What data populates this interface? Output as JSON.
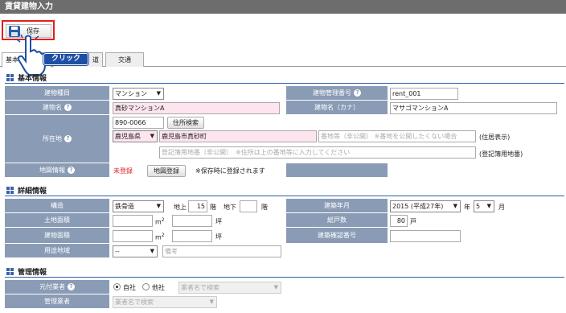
{
  "window": {
    "title": "賃貸建物入力"
  },
  "toolbar": {
    "save_label": "保存",
    "click_badge": "クリック"
  },
  "tabs": [
    {
      "label": "基本"
    },
    {
      "label": "道"
    },
    {
      "label": "交通"
    }
  ],
  "sections": {
    "basic": "基本情報",
    "detail": "詳細情報",
    "mgmt": "管理情報"
  },
  "basic": {
    "type_label": "建物種目",
    "type_value": "マンション",
    "mgmt_no_label": "建物管理番号",
    "mgmt_no_value": "rent_001",
    "name_label": "建物名",
    "name_value": "真砂マンションA",
    "kana_label": "建物名（カナ）",
    "kana_value": "マサゴマンションA",
    "address_label": "所在地",
    "zip_value": "890-0066",
    "zip_button": "住所検索",
    "pref_value": "鹿児島県",
    "city_value": "鹿児島市真砂町",
    "street_placeholder": "番地等（非公開）",
    "street_note": "※番地を公開したくない場合",
    "display_label": "(住居表示)",
    "reg_placeholder": "登記簿用地番（非公開）",
    "reg_note": "※住所は上の番地等に入力してください",
    "reg_label": "(登記簿用地番)",
    "map_label": "地図情報",
    "map_status": "未登録",
    "map_button": "地図登録",
    "map_note": "※保存時に登録されます"
  },
  "detail": {
    "structure_label": "構造",
    "structure_value": "鉄骨造",
    "above_label": "地上",
    "above_value": "15",
    "floor_unit": "階",
    "below_label": "地下",
    "below_unit": "階",
    "built_label": "建築年月",
    "year_value": "2015 (平成27年)",
    "year_unit": "年",
    "month_value": "5",
    "month_unit": "月",
    "land_label": "土地面積",
    "m2": "m",
    "sup": "2",
    "tsubo": "坪",
    "units_label": "総戸数",
    "units_value": "80",
    "units_unit": "戸",
    "bldg_label": "建物面積",
    "permit_label": "建築確認番号",
    "zone_label": "用途地域",
    "zone_value": "--",
    "zone_note_placeholder": "備考"
  },
  "mgmt": {
    "agent_label": "元付業者",
    "own_label": "自社",
    "other_label": "他社",
    "agent_search_placeholder": "業者名で検索",
    "manager_label": "管理業者",
    "manager_search_placeholder": "業者名で検索"
  },
  "colors": {
    "label_bg": "#8a9bb5",
    "required_pink": "#fde4ef",
    "accent_blue": "#2b5fa8",
    "status_red": "#e02020"
  }
}
